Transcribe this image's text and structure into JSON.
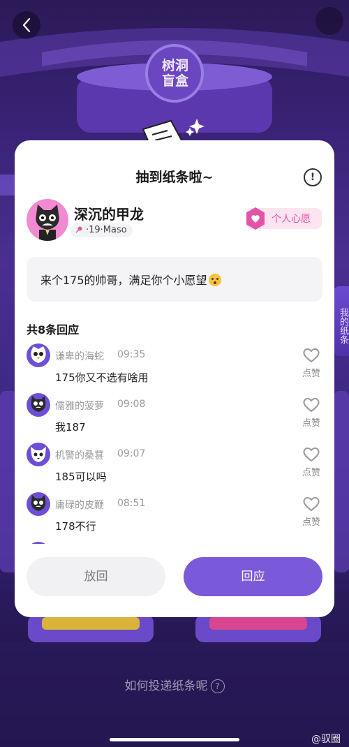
{
  "header": {
    "box_title": "树洞盲盒"
  },
  "side_tab": {
    "label": "我的纸条"
  },
  "card": {
    "title": "抽到纸条啦~",
    "user": {
      "name": "深沉的甲龙",
      "meta": "·19·Maso"
    },
    "badge": "个人心愿",
    "note": "来个175的帅哥，满足你个小愿望",
    "reply_count": "共8条回应",
    "replies": [
      {
        "nick": "谦卑的海蛇",
        "time": "09:35",
        "content": "175你又不选有啥用",
        "like": "点赞"
      },
      {
        "nick": "儒雅的菠萝",
        "time": "09:08",
        "content": "我187",
        "like": "点赞"
      },
      {
        "nick": "机警的桑葚",
        "time": "09:07",
        "content": "185可以吗",
        "like": "点赞"
      },
      {
        "nick": "庸碌的皮鞭",
        "time": "08:51",
        "content": "178不行",
        "like": "点赞"
      }
    ],
    "buttons": {
      "return": "放回",
      "reply": "回应"
    }
  },
  "footer": {
    "how_to": "如何投递纸条呢",
    "watermark": "@驭圈"
  },
  "colors": {
    "accent": "#7a5ad8",
    "badge_pink": "#e255a6",
    "avatar_pink": "#f18ad1"
  }
}
